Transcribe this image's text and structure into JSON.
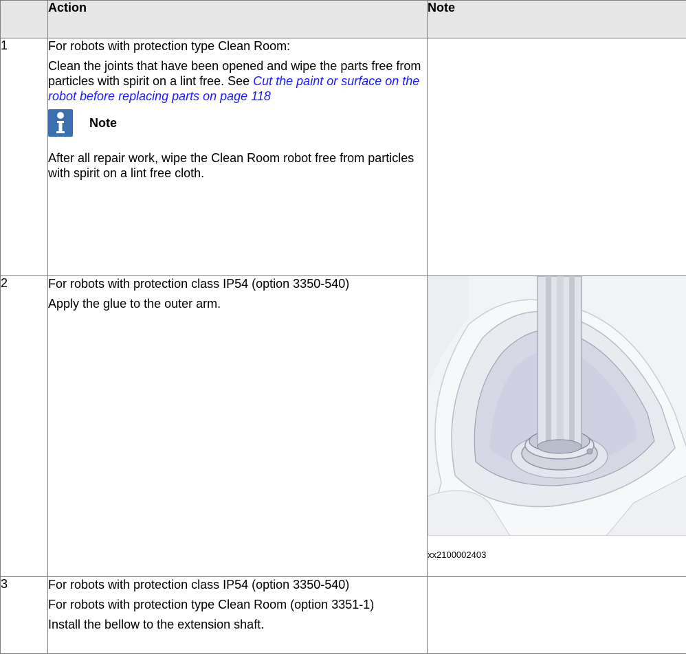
{
  "table": {
    "header": {
      "num": "",
      "action": "Action",
      "note": "Note"
    },
    "rows": [
      {
        "num": "1",
        "p1": "For robots with protection type Clean Room:",
        "p2_text": "Clean the joints that have been opened and wipe the parts free from particles with spirit on a lint free. See ",
        "p2_link": "Cut the paint or surface on the robot before replacing parts on page 118",
        "note_label": "Note",
        "note_text": "After all repair work, wipe the Clean Room robot free from particles with spirit on a lint free cloth.",
        "note_icon": "info-icon"
      },
      {
        "num": "2",
        "p1": "For robots with protection class IP54 (option 3350-540)",
        "p2": "Apply the glue to the outer arm.",
        "figure_caption": "xx2100002403"
      },
      {
        "num": "3",
        "p1": "For robots with protection class IP54 (option 3350-540)",
        "p2": "For robots with protection type Clean Room (option 3351-1)",
        "p3": "Install the bellow to the extension shaft."
      }
    ]
  },
  "colors": {
    "header_bg": "#e6e6e6",
    "border": "#7f7f7f",
    "link": "#1a1aff",
    "note_icon_bg": "#3a6fb0"
  }
}
